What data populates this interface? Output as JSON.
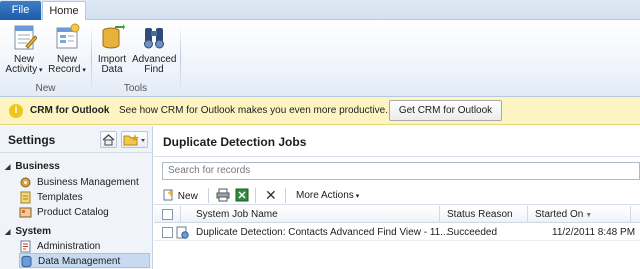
{
  "tabs": {
    "file": "File",
    "home": "Home"
  },
  "ribbon": {
    "new_activity": "New Activity",
    "new_record": "New Record",
    "import_data": "Import Data",
    "advanced_find": "Advanced Find",
    "group_new": "New",
    "group_tools": "Tools"
  },
  "infobar": {
    "title": "CRM for Outlook",
    "message": "See how CRM for Outlook makes you even more productive.",
    "button": "Get CRM for Outlook"
  },
  "nav": {
    "title": "Settings",
    "sections": [
      {
        "label": "Business",
        "items": [
          "Business Management",
          "Templates",
          "Product Catalog"
        ]
      },
      {
        "label": "System",
        "items": [
          "Administration",
          "Data Management"
        ]
      }
    ],
    "selected": "Data Management"
  },
  "main": {
    "title": "Duplicate Detection Jobs",
    "search_placeholder": "Search for records",
    "toolbar": {
      "new": "New",
      "more_actions": "More Actions"
    },
    "columns": [
      "System Job Name",
      "Status Reason",
      "Started On"
    ],
    "rows": [
      {
        "name": "Duplicate Detection: Contacts Advanced Find View - 11...",
        "status": "Succeeded",
        "started": "11/2/2011 8:48 PM"
      }
    ]
  }
}
